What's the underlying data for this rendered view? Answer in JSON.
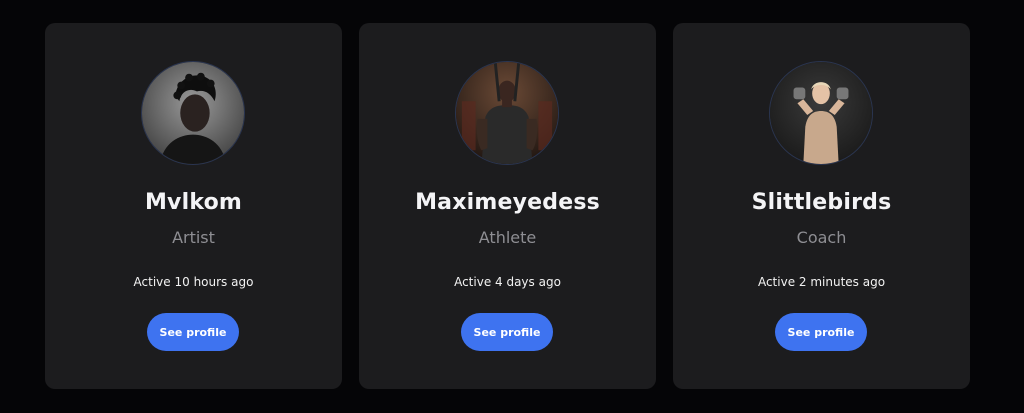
{
  "colors": {
    "background": "#050507",
    "card": "#1c1c1e",
    "accent": "#3e73f0",
    "name_text": "#f4f4f6",
    "role_text": "#8e8e93"
  },
  "profiles": [
    {
      "name": "Mvlkom",
      "role": "Artist",
      "activity": "Active 10 hours ago",
      "button_label": "See profile",
      "avatar_icon": "person-portrait-icon"
    },
    {
      "name": "Maximeyedess",
      "role": "Athlete",
      "activity": "Active 4 days ago",
      "button_label": "See profile",
      "avatar_icon": "person-portrait-icon"
    },
    {
      "name": "Slittlebirds",
      "role": "Coach",
      "activity": "Active 2 minutes ago",
      "button_label": "See profile",
      "avatar_icon": "person-portrait-icon"
    }
  ]
}
